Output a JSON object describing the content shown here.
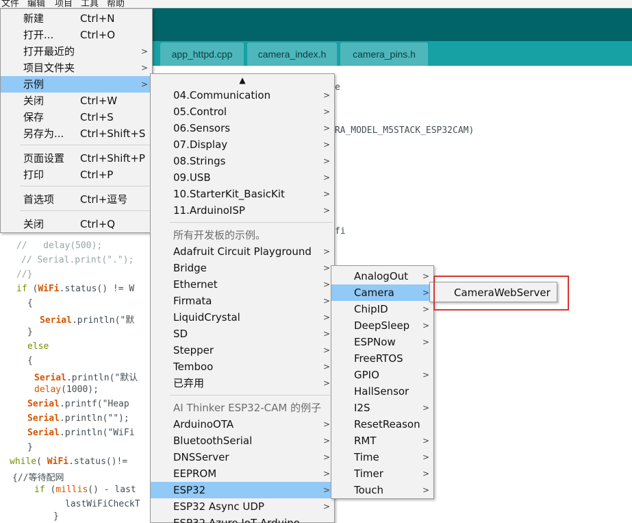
{
  "menubar": {
    "items": [
      "文件",
      "编辑",
      "项目",
      "工具",
      "帮助"
    ]
  },
  "tabs": [
    {
      "label": "app_httpd.cpp"
    },
    {
      "label": "camera_index.h"
    },
    {
      "label": "camera_pins.h"
    }
  ],
  "code": {
    "line1_tail": "e",
    "line2_tail": "ERA_MODEL_M5STACK_ESP32CAM)",
    "line3_tail": "fi",
    "line4": "//   delay(500);",
    "line5": "// Serial.print(\".\");",
    "line6": "//}",
    "line7_kw": "if",
    "line7_a": " (",
    "line7_wifi": "WiFi",
    "line7_b": ".status() != W",
    "line8": "{",
    "line9_obj": "Serial",
    "line9_b": ".println(\"默",
    "line10": "}",
    "line11": "else",
    "line12": "{",
    "line13_obj": "Serial",
    "line13_b": ".println(\"默认",
    "line14_fn": "delay",
    "line14_b": "(1000);",
    "line15_obj": "Serial",
    "line15_b": ".printf(\"Heap",
    "line16_obj": "Serial",
    "line16_b": ".println(\"\");",
    "line17_obj": "Serial",
    "line17_b": ".println(\"WiFi",
    "line18": "}",
    "line19_kw": "while",
    "line19_a": "( ",
    "line19_wifi": "WiFi",
    "line19_b": ".status()!=",
    "line20": "{//等待配网",
    "line21_kw": "if",
    "line21_a": " (",
    "line21_fn": "millis",
    "line21_b": "() - last",
    "line22": "lastWiFiCheckT",
    "line23": "}"
  },
  "file_menu": {
    "items": [
      {
        "label": "新建",
        "shortcut": "Ctrl+N"
      },
      {
        "label": "打开...",
        "shortcut": "Ctrl+O"
      },
      {
        "label": "打开最近的",
        "shortcut": ""
      },
      {
        "label": "项目文件夹",
        "shortcut": ""
      },
      {
        "label": "示例",
        "shortcut": ""
      },
      {
        "label": "关闭",
        "shortcut": "Ctrl+W"
      },
      {
        "label": "保存",
        "shortcut": "Ctrl+S"
      },
      {
        "label": "另存为...",
        "shortcut": "Ctrl+Shift+S"
      },
      {
        "label": "页面设置",
        "shortcut": "Ctrl+Shift+P"
      },
      {
        "label": "打印",
        "shortcut": "Ctrl+P"
      },
      {
        "label": "首选项",
        "shortcut": "Ctrl+逗号"
      },
      {
        "label": "关闭",
        "shortcut": "Ctrl+Q"
      }
    ],
    "selected": "示例"
  },
  "examples_menu": {
    "scroll_up": "▲",
    "builtin": [
      "04.Communication",
      "05.Control",
      "06.Sensors",
      "07.Display",
      "08.Strings",
      "09.USB",
      "10.StarterKit_BasicKit",
      "11.ArduinoISP"
    ],
    "all_boards_header": "所有开发板的示例。",
    "all_boards": [
      "Adafruit Circuit Playground",
      "Bridge",
      "Ethernet",
      "Firmata",
      "LiquidCrystal",
      "SD",
      "Stepper",
      "Temboo",
      "已弃用"
    ],
    "board_header": "AI Thinker ESP32-CAM 的例子",
    "board": [
      "ArduinoOTA",
      "BluetoothSerial",
      "DNSServer",
      "EEPROM",
      "ESP32",
      "ESP32 Async UDP",
      "ESP32 Azure IoT Arduino"
    ],
    "selected": "ESP32"
  },
  "esp32_menu": {
    "items": [
      {
        "label": "AnalogOut",
        "submenu": true
      },
      {
        "label": "Camera",
        "submenu": true
      },
      {
        "label": "ChipID",
        "submenu": true
      },
      {
        "label": "DeepSleep",
        "submenu": true
      },
      {
        "label": "ESPNow",
        "submenu": true
      },
      {
        "label": "FreeRTOS",
        "submenu": false
      },
      {
        "label": "GPIO",
        "submenu": true
      },
      {
        "label": "HallSensor",
        "submenu": false
      },
      {
        "label": "I2S",
        "submenu": true
      },
      {
        "label": "ResetReason",
        "submenu": false
      },
      {
        "label": "RMT",
        "submenu": true
      },
      {
        "label": "Time",
        "submenu": true
      },
      {
        "label": "Timer",
        "submenu": true
      },
      {
        "label": "Touch",
        "submenu": true
      }
    ],
    "selected": "Camera"
  },
  "camera_menu": {
    "items": [
      "CameraWebServer"
    ]
  },
  "icons": {
    "submenu_arrow": "chevron-right-icon",
    "scroll_up": "triangle-up-icon"
  },
  "colors": {
    "toolbar": "#006468",
    "tabbar": "#17a1a5",
    "selection": "#91c9f7",
    "annotation_box": "#d9332e"
  }
}
